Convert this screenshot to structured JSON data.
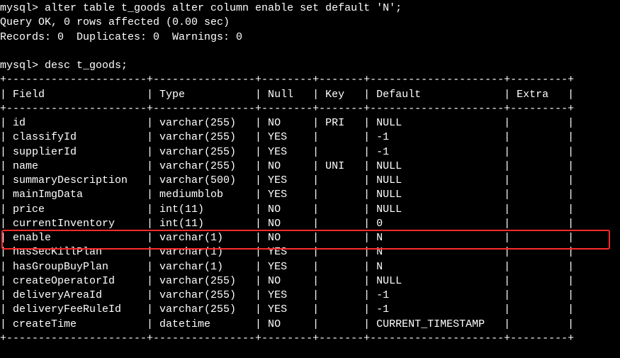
{
  "prompt": "mysql>",
  "cmd1": "alter table t_goods alter column enable set default 'N';",
  "res1a": "Query OK, 0 rows affected (0.00 sec)",
  "res1b": "Records: 0  Duplicates: 0  Warnings: 0",
  "cmd2": "desc t_goods;",
  "headers": {
    "field": "Field",
    "type": "Type",
    "null": "Null",
    "key": "Key",
    "default": "Default",
    "extra": "Extra"
  },
  "rows": [
    {
      "field": "id",
      "type": "varchar(255)",
      "null": "NO",
      "key": "PRI",
      "default": "NULL",
      "extra": ""
    },
    {
      "field": "classifyId",
      "type": "varchar(255)",
      "null": "YES",
      "key": "",
      "default": "-1",
      "extra": ""
    },
    {
      "field": "supplierId",
      "type": "varchar(255)",
      "null": "YES",
      "key": "",
      "default": "-1",
      "extra": ""
    },
    {
      "field": "name",
      "type": "varchar(255)",
      "null": "NO",
      "key": "UNI",
      "default": "NULL",
      "extra": ""
    },
    {
      "field": "summaryDescription",
      "type": "varchar(500)",
      "null": "YES",
      "key": "",
      "default": "NULL",
      "extra": ""
    },
    {
      "field": "mainImgData",
      "type": "mediumblob",
      "null": "YES",
      "key": "",
      "default": "NULL",
      "extra": ""
    },
    {
      "field": "price",
      "type": "int(11)",
      "null": "NO",
      "key": "",
      "default": "NULL",
      "extra": ""
    },
    {
      "field": "currentInventory",
      "type": "int(11)",
      "null": "NO",
      "key": "",
      "default": "0",
      "extra": ""
    },
    {
      "field": "enable",
      "type": "varchar(1)",
      "null": "NO",
      "key": "",
      "default": "N",
      "extra": ""
    },
    {
      "field": "hasSecKillPlan",
      "type": "varchar(1)",
      "null": "YES",
      "key": "",
      "default": "N",
      "extra": ""
    },
    {
      "field": "hasGroupBuyPlan",
      "type": "varchar(1)",
      "null": "YES",
      "key": "",
      "default": "N",
      "extra": ""
    },
    {
      "field": "createOperatorId",
      "type": "varchar(255)",
      "null": "NO",
      "key": "",
      "default": "NULL",
      "extra": ""
    },
    {
      "field": "deliveryAreaId",
      "type": "varchar(255)",
      "null": "YES",
      "key": "",
      "default": "-1",
      "extra": ""
    },
    {
      "field": "deliveryFeeRuleId",
      "type": "varchar(255)",
      "null": "YES",
      "key": "",
      "default": "-1",
      "extra": ""
    },
    {
      "field": "createTime",
      "type": "datetime",
      "null": "NO",
      "key": "",
      "default": "CURRENT_TIMESTAMP",
      "extra": ""
    }
  ],
  "col_widths": {
    "field": 20,
    "type": 14,
    "null": 6,
    "key": 5,
    "default": 19,
    "extra": 7
  },
  "highlight_row_index": 8
}
